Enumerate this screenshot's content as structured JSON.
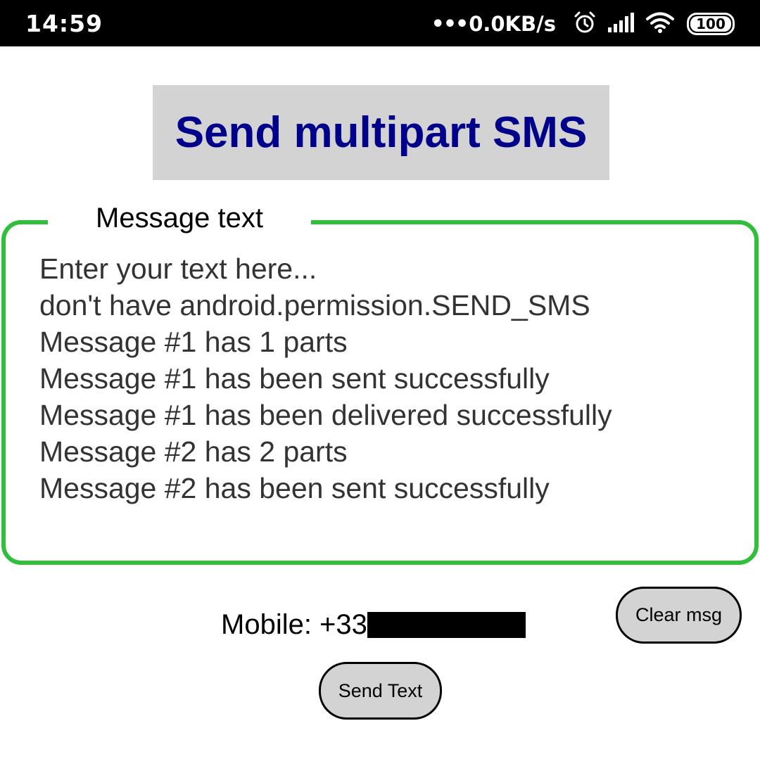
{
  "status_bar": {
    "time": "14:59",
    "dots": "•••",
    "network_speed": "0.0KB/s",
    "battery": "100",
    "icons": [
      "alarm-icon",
      "signal-icon",
      "wifi-icon",
      "battery-icon"
    ]
  },
  "header": {
    "title": "Send multipart SMS"
  },
  "message_box": {
    "legend": "Message text",
    "lines": [
      "Enter your text here...",
      "don't have android.permission.SEND_SMS",
      "Message #1 has 1 parts",
      "Message #1 has been sent successfully",
      "Message #1 has been delivered successfully",
      "Message #2 has 2 parts",
      "Message #2 has been sent successfully"
    ]
  },
  "mobile": {
    "label": "Mobile: +33"
  },
  "buttons": {
    "clear_label": "Clear msg",
    "send_label": "Send Text"
  },
  "colors": {
    "title_text": "#00008b",
    "title_background": "#d3d3d3",
    "frame_border": "#2fbf3a",
    "button_background": "#d3d3d3"
  }
}
